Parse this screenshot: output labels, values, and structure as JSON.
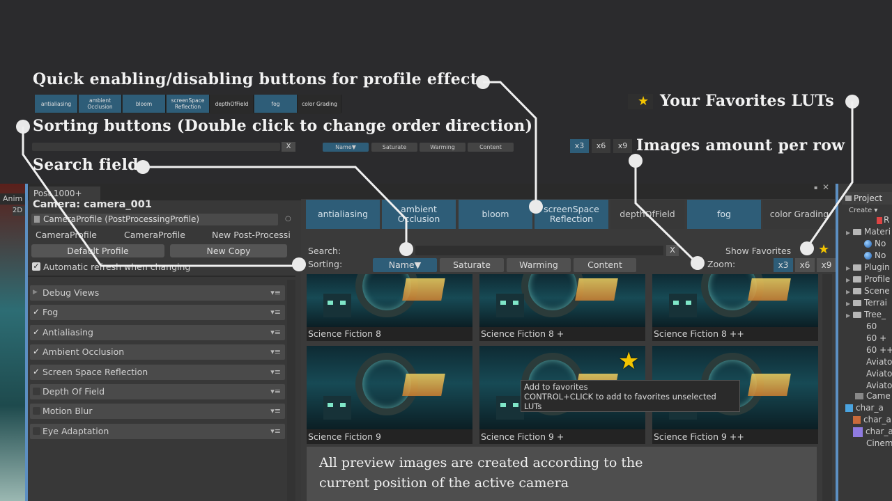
{
  "callouts": {
    "quick": "Quick enabling/disabling buttons for profile effects",
    "sorting": "Sorting buttons (Double click to change order direction)",
    "search": "Search field",
    "favorites": "Your Favorites LUTs",
    "images_per_row": "Images amount per row",
    "preview_note_line1": "All preview images are created according to the",
    "preview_note_line2": "current position of the active camera"
  },
  "mini_toolbar": {
    "effects": [
      "antialiasing",
      "ambient Occlusion",
      "bloom",
      "screenSpace Reflection",
      "depthOfField",
      "fog",
      "color Grading"
    ],
    "search_clear": "X",
    "sort": [
      "Name▼",
      "Saturate",
      "Warming",
      "Content"
    ],
    "zoom": [
      "x3",
      "x6",
      "x9"
    ]
  },
  "left_strip": {
    "tab": "Anim",
    "mode": "2D"
  },
  "window": {
    "tab_label": "Post 1000+",
    "camera_title": "Camera: camera_001",
    "profile_field": "CameraProfile (PostProcessingProfile)",
    "profile_options": [
      "CameraProfile",
      "CameraProfile",
      "New Post-Processi"
    ],
    "default_profile_button": "Default Profile",
    "new_copy_button": "New Copy",
    "auto_refresh_label": "Automatic refresh when changing",
    "effect_rows": [
      {
        "label": "Debug Views",
        "checked": false,
        "arrow": true
      },
      {
        "label": "Fog",
        "checked": true
      },
      {
        "label": "Antialiasing",
        "checked": true
      },
      {
        "label": "Ambient Occlusion",
        "checked": true
      },
      {
        "label": "Screen Space Reflection",
        "checked": true
      },
      {
        "label": "Depth Of Field",
        "checked": false
      },
      {
        "label": "Motion Blur",
        "checked": false
      },
      {
        "label": "Eye Adaptation",
        "checked": false
      }
    ],
    "row_menu": "▾≡"
  },
  "right_panel": {
    "effects": [
      {
        "label": "antialiasing",
        "on": true
      },
      {
        "label": "ambient Occlusion",
        "on": true
      },
      {
        "label": "bloom",
        "on": true
      },
      {
        "label": "screenSpace Reflection",
        "on": true
      },
      {
        "label": "depthOfField",
        "on": false
      },
      {
        "label": "fog",
        "on": true
      },
      {
        "label": "color Grading",
        "on": false
      }
    ],
    "search_label": "Search:",
    "sorting_label": "Sorting:",
    "clear": "X",
    "show_favorites": "Show Favorites",
    "zoom_label": "Zoom:",
    "sort": [
      "Name▼",
      "Saturate",
      "Warming",
      "Content"
    ],
    "zoom": [
      "x3",
      "x6",
      "x9"
    ],
    "thumbnails": [
      "Science Fiction 8",
      "Science Fiction 8 +",
      "Science Fiction 8 ++",
      "Science Fiction 9",
      "Science Fiction 9 +",
      "Science Fiction 9 ++"
    ],
    "tooltip": {
      "line1": "Add to favorites",
      "line2": "CONTROL+CLICK to add to favorites unselected",
      "line3": "LUTs"
    }
  },
  "project": {
    "tab": "Project",
    "create": "Create ▾",
    "items": [
      {
        "text": "R",
        "kind": "file"
      },
      {
        "text": "Materi",
        "kind": "folder"
      },
      {
        "text": "No",
        "kind": "sphere"
      },
      {
        "text": "No",
        "kind": "sphere"
      },
      {
        "text": "Plugin",
        "kind": "folder"
      },
      {
        "text": "Profile",
        "kind": "folder"
      },
      {
        "text": "Scene",
        "kind": "folder"
      },
      {
        "text": "Terrai",
        "kind": "folder"
      },
      {
        "text": "Tree_",
        "kind": "folder"
      },
      {
        "text": "60",
        "kind": "plain"
      },
      {
        "text": "60 +",
        "kind": "plain"
      },
      {
        "text": "60 ++",
        "kind": "plain"
      },
      {
        "text": "Aviato",
        "kind": "plain"
      },
      {
        "text": "Aviato",
        "kind": "plain"
      },
      {
        "text": "Aviato",
        "kind": "plain"
      },
      {
        "text": "Came",
        "kind": "camera"
      },
      {
        "text": "char_a",
        "kind": "cube"
      },
      {
        "text": "char_a",
        "kind": "char"
      },
      {
        "text": "char_a",
        "kind": "purple"
      },
      {
        "text": "Cinem",
        "kind": "plain"
      }
    ]
  },
  "colors": {
    "accent": "#2e5d78",
    "background": "#2b2b2d",
    "panel": "#383838",
    "star": "#f3c400"
  }
}
